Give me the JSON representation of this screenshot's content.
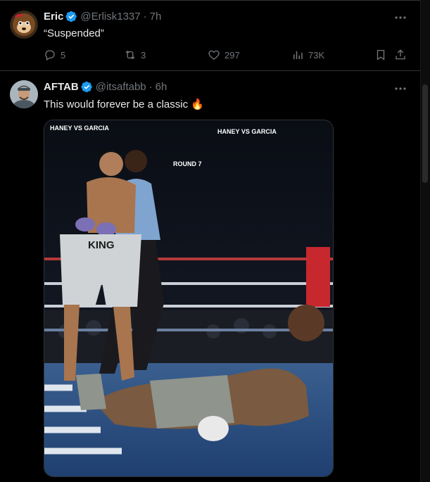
{
  "tweets": [
    {
      "name": "Eric",
      "handle": "@Erlisk1337",
      "dot": "·",
      "time": "7h",
      "text": "“Suspended”",
      "stats": {
        "replies": "5",
        "reposts": "3",
        "likes": "297",
        "views": "73K"
      }
    },
    {
      "name": "AFTAB",
      "handle": "@itsaftabb",
      "dot": "·",
      "time": "6h",
      "text": "This would forever be a classic 🔥",
      "media": {
        "overlay_left": "HANEY VS GARCIA",
        "overlay_right": "HANEY VS GARCIA",
        "round": "ROUND 7",
        "trunks": "KING"
      }
    }
  ],
  "colors": {
    "accent": "#1d9bf0",
    "muted": "#71767b",
    "text": "#e7e9ea",
    "border": "#2f3336"
  }
}
